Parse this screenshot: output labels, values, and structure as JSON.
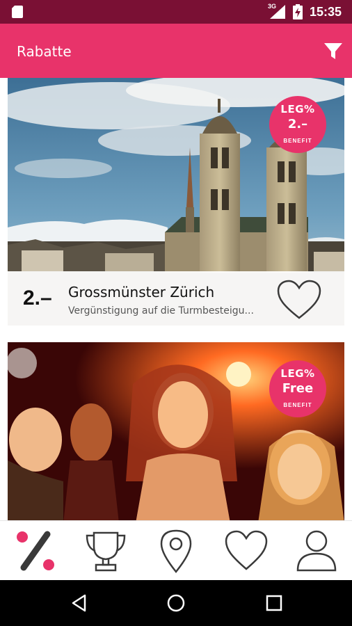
{
  "status_bar": {
    "network_type": "3G",
    "time": "15:35",
    "icons": [
      "sd-card-icon",
      "signal-icon",
      "battery-charging-icon"
    ]
  },
  "app_bar": {
    "title": "Rabatte",
    "icons": [
      "filter-icon"
    ]
  },
  "deals": [
    {
      "badge_brand": "LEG%",
      "badge_value": "2.–",
      "badge_sub": "BENEFIT",
      "price": "2.–",
      "name": "Grossmünster Zürich",
      "description": "Vergünstigung auf die Turmbesteigu...",
      "image_subject": "Grossmünster church towers in Zurich"
    },
    {
      "badge_brand": "LEG%",
      "badge_value": "Free",
      "badge_sub": "BENEFIT",
      "image_subject": "People dancing at a party"
    }
  ],
  "bottom_nav": {
    "items": [
      {
        "icon": "discount-icon",
        "active": true
      },
      {
        "icon": "trophy-icon",
        "active": false
      },
      {
        "icon": "location-pin-icon",
        "active": false
      },
      {
        "icon": "heart-icon",
        "active": false
      },
      {
        "icon": "profile-icon",
        "active": false
      }
    ]
  },
  "system_nav": {
    "icons": [
      "back-icon",
      "home-icon",
      "recents-icon"
    ]
  },
  "colors": {
    "accent": "#e8336a",
    "status_bar": "#7a1034",
    "icon_dark": "#3a3a3a"
  }
}
